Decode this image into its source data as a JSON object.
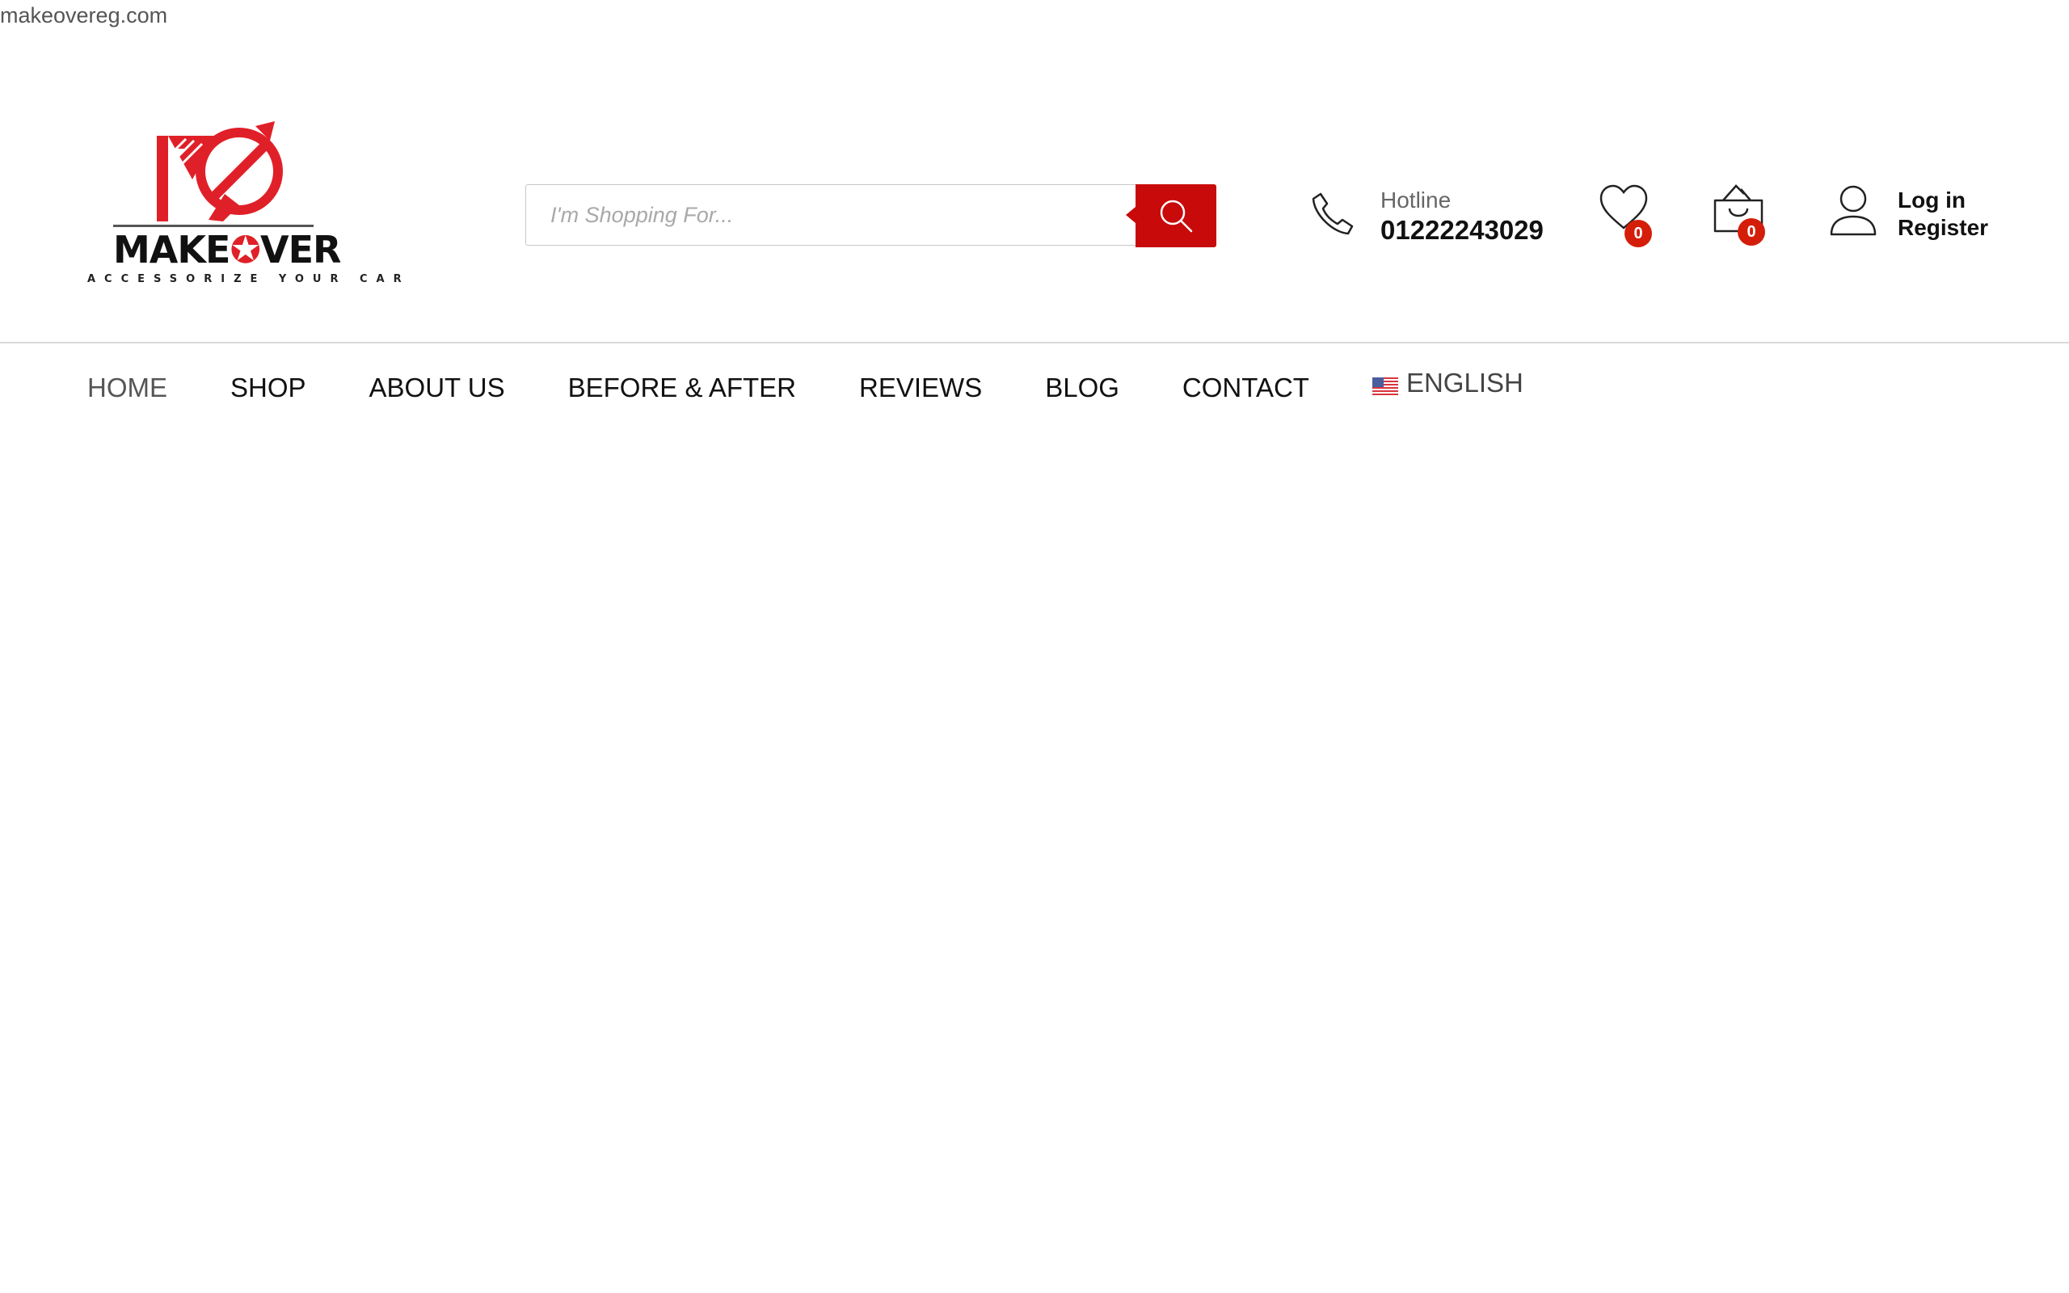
{
  "site": {
    "url": "makeovereg.com"
  },
  "logo": {
    "brand_prefix": "MAKE",
    "brand_star": "✪",
    "brand_suffix": "VER",
    "tagline": "ACCESSORIZE YOUR CAR",
    "colors": {
      "red": "#e02028",
      "dark": "#111111"
    }
  },
  "search": {
    "placeholder": "I'm Shopping For...",
    "value": "",
    "button_icon": "search-icon",
    "button_color": "#c80a0a"
  },
  "hotline": {
    "icon": "phone-icon",
    "label": "Hotline",
    "number": "01222243029"
  },
  "wishlist": {
    "icon": "heart-icon",
    "count": "0"
  },
  "cart": {
    "icon": "shopping-bag-icon",
    "count": "0"
  },
  "account": {
    "icon": "user-icon",
    "login_label": "Log in",
    "register_label": "Register"
  },
  "nav": {
    "items": [
      {
        "label": "HOME",
        "active": true
      },
      {
        "label": "SHOP"
      },
      {
        "label": "ABOUT US"
      },
      {
        "label": "BEFORE & AFTER"
      },
      {
        "label": "REVIEWS"
      },
      {
        "label": "BLOG"
      },
      {
        "label": "CONTACT"
      }
    ],
    "language": {
      "icon": "us-flag-icon",
      "label": "ENGLISH"
    }
  },
  "colors": {
    "accent": "#c80a0a",
    "badge": "#d41e0a",
    "divider": "#d9d9d9"
  }
}
